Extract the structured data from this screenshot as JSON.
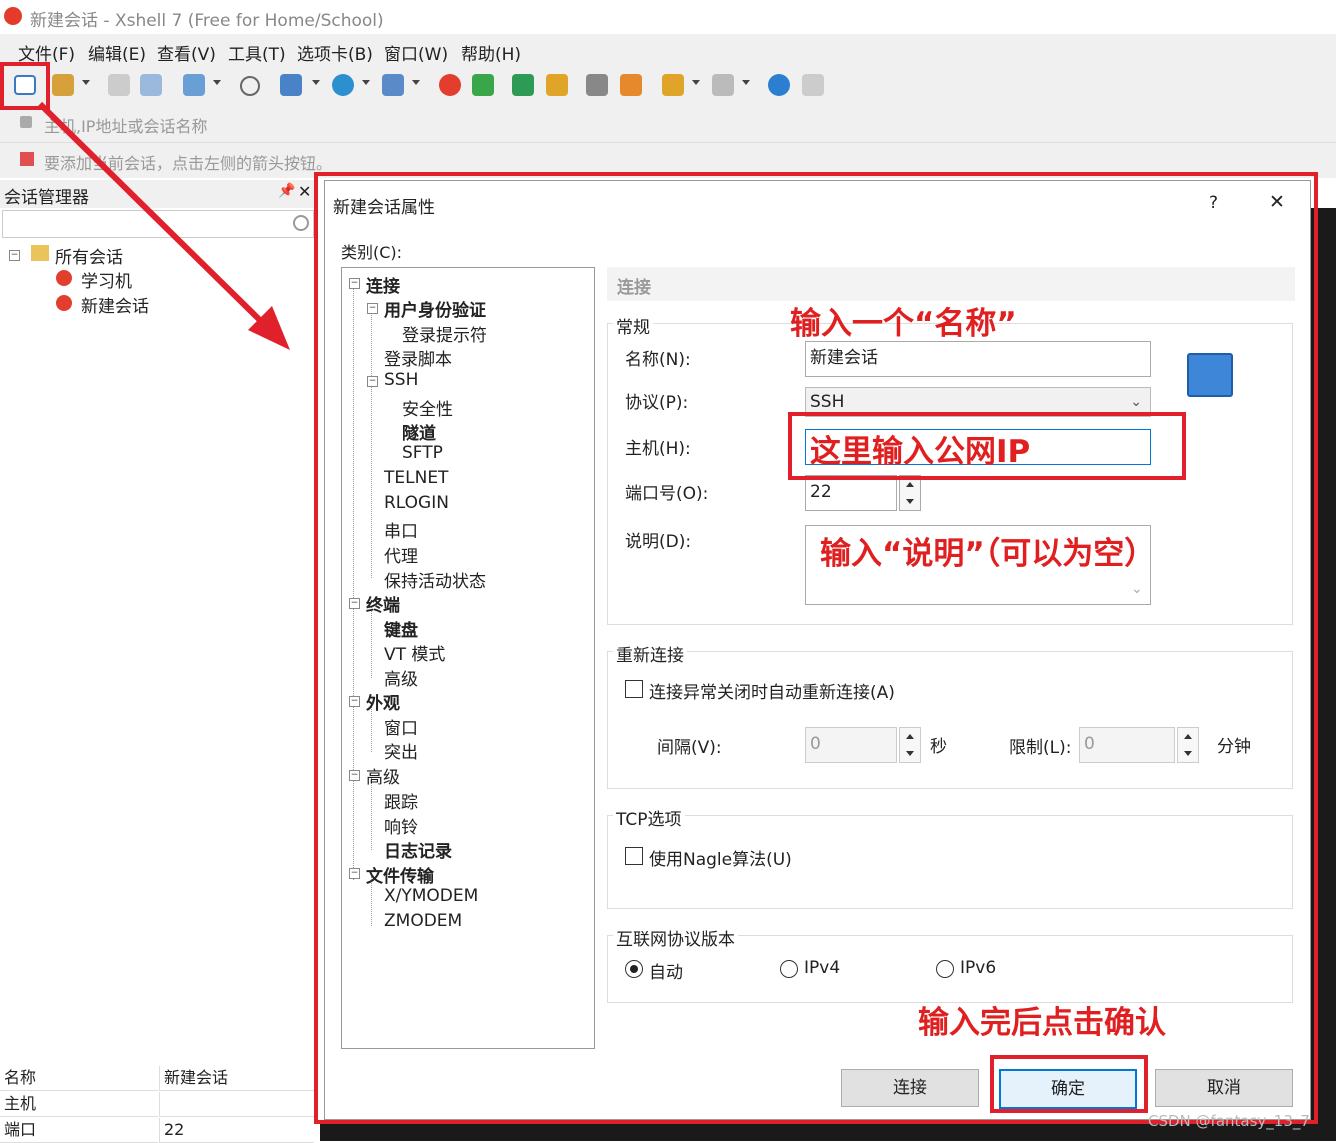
{
  "window": {
    "title": "新建会话 - Xshell 7 (Free for Home/School)"
  },
  "menu": [
    "文件(F)",
    "编辑(E)",
    "查看(V)",
    "工具(T)",
    "选项卡(B)",
    "窗口(W)",
    "帮助(H)"
  ],
  "address_bar": {
    "placeholder": "主机,IP地址或会话名称"
  },
  "hint_bar": {
    "text": "要添加当前会话，点击左侧的箭头按钮。"
  },
  "session_manager": {
    "title": "会话管理器",
    "tree": {
      "root": "所有会话",
      "children": [
        "学习机",
        "新建会话"
      ]
    },
    "properties": [
      {
        "key": "名称",
        "value": "新建会话"
      },
      {
        "key": "主机",
        "value": ""
      },
      {
        "key": "端口",
        "value": "22"
      }
    ]
  },
  "dialog": {
    "title": "新建会话属性",
    "help_glyph": "?",
    "close_glyph": "✕",
    "category_label": "类别(C):",
    "categories": [
      "连接",
      "用户身份验证",
      "登录提示符",
      "登录脚本",
      "SSH",
      "安全性",
      "隧道",
      "SFTP",
      "TELNET",
      "RLOGIN",
      "串口",
      "代理",
      "保持活动状态",
      "终端",
      "键盘",
      "VT 模式",
      "高级",
      "外观",
      "窗口",
      "突出",
      "高级",
      "跟踪",
      "响铃",
      "日志记录",
      "文件传输",
      "X/YMODEM",
      "ZMODEM"
    ],
    "section_header": "连接",
    "general": {
      "title": "常规",
      "name_label": "名称(N):",
      "name_value": "新建会话",
      "protocol_label": "协议(P):",
      "protocol_value": "SSH",
      "host_label": "主机(H):",
      "host_value": "",
      "port_label": "端口号(O):",
      "port_value": "22",
      "desc_label": "说明(D):",
      "desc_value": ""
    },
    "reconnect": {
      "title": "重新连接",
      "checkbox_label": "连接异常关闭时自动重新连接(A)",
      "interval_label": "间隔(V):",
      "interval_value": "0",
      "interval_unit": "秒",
      "limit_label": "限制(L):",
      "limit_value": "0",
      "limit_unit": "分钟"
    },
    "tcp": {
      "title": "TCP选项",
      "nagle_label": "使用Nagle算法(U)"
    },
    "ip_version": {
      "title": "互联网协议版本",
      "options": [
        "自动",
        "IPv4",
        "IPv6"
      ],
      "selected": "自动"
    },
    "buttons": {
      "connect": "连接",
      "ok": "确定",
      "cancel": "取消"
    }
  },
  "annotations": {
    "name_hint": "输入一个“名称”",
    "host_hint": "这里输入公网IP",
    "desc_hint": "输入“说明”（可以为空）",
    "confirm_hint": "输入完后点击确认"
  },
  "watermark": "CSDN @fantasy_13_7",
  "colors": {
    "annotation_red": "#e0202a",
    "primary_button_border": "#0078d7",
    "chrome_gray": "#f0f0f0"
  }
}
